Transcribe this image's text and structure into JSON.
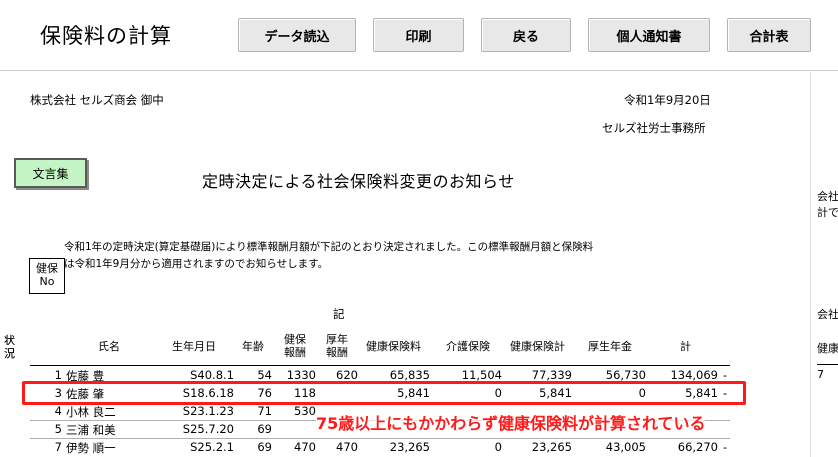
{
  "header": {
    "title": "保険料の計算",
    "buttons": {
      "data_read": "データ読込",
      "print": "印刷",
      "back": "戻る",
      "individual_notice": "個人通知書",
      "total_table": "合計表"
    }
  },
  "letter": {
    "addressee": "株式会社 セルズ商会 御中",
    "date": "令和1年9月20日",
    "sender": "セルズ社労士事務所",
    "bunsho_button": "文言集",
    "title": "定時決定による社会保険料変更のお知らせ",
    "body_line1": "令和1年の定時決定(算定基礎届)により標準報酬月額が下記のとおり決定されました。この標準報酬月額と保険料",
    "body_line2": "は令和1年9月分から適用されますのでお知らせします。",
    "ki": "記"
  },
  "table": {
    "headers": {
      "status": [
        "状",
        "況"
      ],
      "health_no": [
        "健保",
        "No"
      ],
      "name": "氏名",
      "birth": "生年月日",
      "age": "年齢",
      "health_reward": [
        "健保",
        "報酬"
      ],
      "pension_reward": [
        "厚年",
        "報酬"
      ],
      "health_premium": "健康保険料",
      "care_premium": "介護保険",
      "health_total": "健康保険計",
      "pension": "厚生年金",
      "total": "計"
    },
    "rows": [
      {
        "no": "1",
        "name": "佐藤 豊",
        "birth": "S40.8.1",
        "age": "54",
        "hr": "1330",
        "pr": "620",
        "hp": "65,835",
        "care": "11,504",
        "ht": "77,339",
        "pen": "56,730",
        "total": "134,069",
        "dash": "-"
      },
      {
        "no": "3",
        "name": "佐藤 肇",
        "birth": "S18.6.18",
        "age": "76",
        "hr": "118",
        "pr": "",
        "hp": "5,841",
        "care": "0",
        "ht": "5,841",
        "pen": "0",
        "total": "5,841",
        "dash": "-"
      },
      {
        "no": "4",
        "name": "小林 良二",
        "birth": "S23.1.23",
        "age": "71",
        "hr": "530",
        "pr": "",
        "hp": "",
        "care": "",
        "ht": "",
        "pen": "",
        "total": "",
        "dash": ""
      },
      {
        "no": "5",
        "name": "三浦 和美",
        "birth": "S25.7.20",
        "age": "69",
        "hr": "",
        "pr": "",
        "hp": "",
        "care": "",
        "ht": "",
        "pen": "",
        "total": "",
        "dash": ""
      },
      {
        "no": "7",
        "name": "伊勢 順一",
        "birth": "S25.2.1",
        "age": "69",
        "hr": "470",
        "pr": "470",
        "hp": "23,265",
        "care": "0",
        "ht": "23,265",
        "pen": "43,005",
        "total": "66,270",
        "dash": "-"
      }
    ]
  },
  "right_strip": {
    "line1": "会社",
    "line2": "計で",
    "line3": "会社",
    "line4": "健康",
    "v1": "7",
    "v2": "",
    "v3": "",
    "v4": ""
  },
  "annotation": "75歳以上にもかかわらず健康保険料が計算されている"
}
